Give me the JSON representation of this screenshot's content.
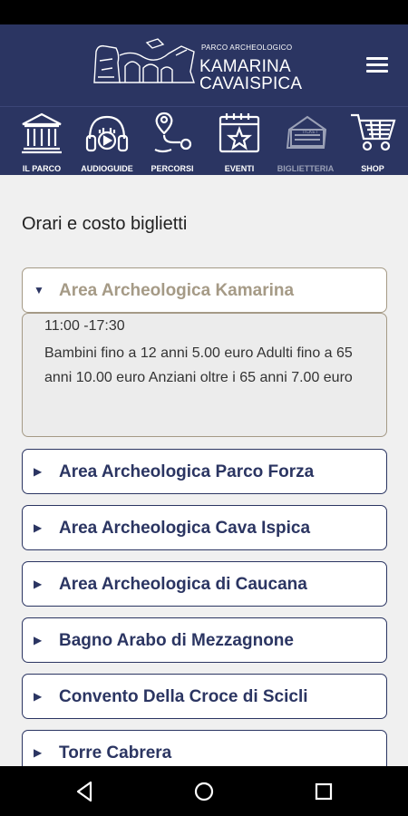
{
  "header": {
    "logo_small": "PARCO ARCHEOLOGICO",
    "logo_line1": "KAMARINA",
    "logo_line2": "CAVAISPICA"
  },
  "tabs": [
    {
      "label": "IL PARCO",
      "icon": "museum-icon"
    },
    {
      "label": "AUDIOGUIDE",
      "icon": "headphones-icon"
    },
    {
      "label": "PERCORSI",
      "icon": "route-icon"
    },
    {
      "label": "EVENTI",
      "icon": "calendar-star-icon"
    },
    {
      "label": "BIGLIETTERIA",
      "icon": "ticket-icon",
      "active": true
    },
    {
      "label": "SHOP",
      "icon": "cart-icon"
    }
  ],
  "main": {
    "title": "Orari e costo biglietti",
    "sections": [
      {
        "title": "Area Archeologica Kamarina",
        "expanded": true,
        "hours": "11:00 -17:30",
        "prices": "Bambini fino a 12 anni 5.00 euro Adulti fino a 65 anni 10.00 euro Anziani oltre i 65 anni 7.00 euro"
      },
      {
        "title": "Area Archeologica Parco Forza",
        "expanded": false
      },
      {
        "title": "Area Archeologica Cava Ispica",
        "expanded": false
      },
      {
        "title": "Area Archeologica di Caucana",
        "expanded": false
      },
      {
        "title": "Bagno Arabo di Mezzagnone",
        "expanded": false
      },
      {
        "title": "Convento Della Croce di Scicli",
        "expanded": false
      },
      {
        "title": "Torre Cabrera",
        "expanded": false
      }
    ]
  },
  "icons": {
    "expanded_arrow": "▼",
    "collapsed_arrow": "▶"
  },
  "colors": {
    "primary": "#2b3562",
    "accent": "#a59a86",
    "background": "#f0f0f0"
  }
}
